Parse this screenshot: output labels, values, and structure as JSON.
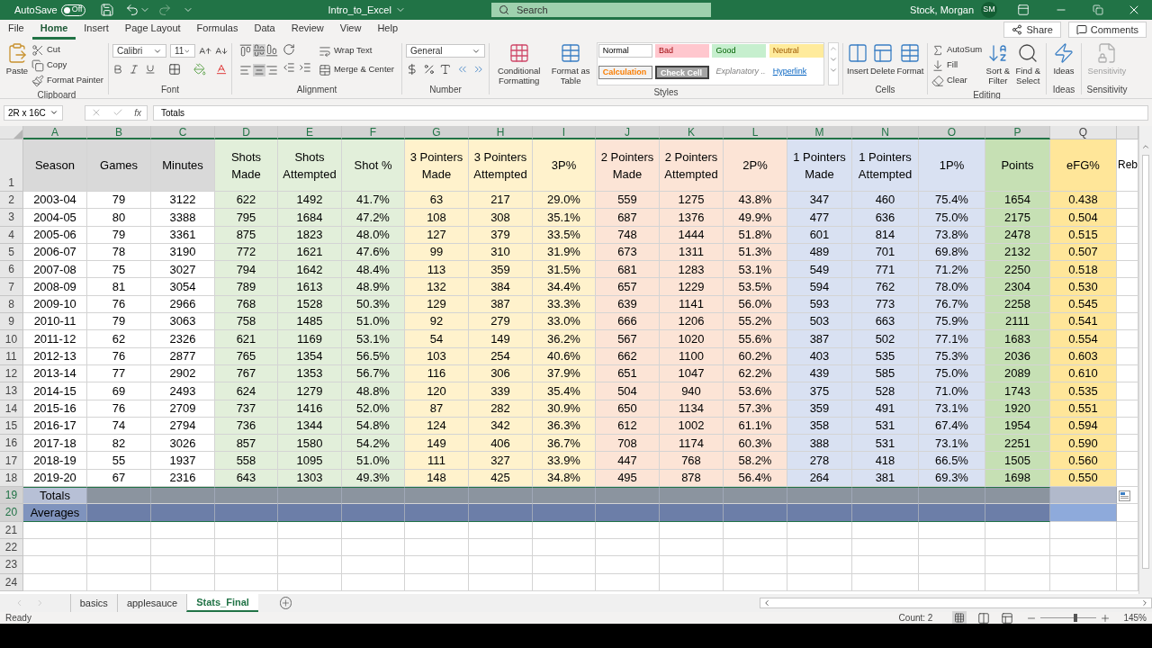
{
  "title_bar": {
    "autosave": {
      "label": "AutoSave",
      "state": "Off",
      "on": false
    },
    "filename": "Intro_to_Excel",
    "search": {
      "placeholder": "Search"
    },
    "user": "Stock, Morgan",
    "initials": "SM"
  },
  "tabs": [
    {
      "label": "File",
      "selected": false
    },
    {
      "label": "Home",
      "selected": true
    },
    {
      "label": "Insert",
      "selected": false
    },
    {
      "label": "Page Layout",
      "selected": false
    },
    {
      "label": "Formulas",
      "selected": false
    },
    {
      "label": "Data",
      "selected": false
    },
    {
      "label": "Review",
      "selected": false
    },
    {
      "label": "View",
      "selected": false
    },
    {
      "label": "Help",
      "selected": false
    }
  ],
  "share": "Share",
  "comments": "Comments",
  "ribbon": {
    "clipboard": {
      "label": "Clipboard",
      "paste": "Paste",
      "cut": "Cut",
      "copy": "Copy",
      "format_painter": "Format Painter"
    },
    "font": {
      "label": "Font",
      "name": "Calibri",
      "size": "11"
    },
    "alignment": {
      "label": "Alignment",
      "wrap": "Wrap Text",
      "merge": "Merge & Center"
    },
    "number": {
      "label": "Number",
      "format": "General"
    },
    "styles": {
      "label": "Styles",
      "conditional": "Conditional Formatting",
      "table": "Format as Table",
      "gallery": [
        {
          "label": "Normal",
          "kind": "normal"
        },
        {
          "label": "Bad",
          "kind": "bad"
        },
        {
          "label": "Good",
          "kind": "good"
        },
        {
          "label": "Neutral",
          "kind": "neutral"
        },
        {
          "label": "Calculation",
          "kind": "calculation"
        },
        {
          "label": "Check Cell",
          "kind": "check"
        },
        {
          "label": "Explanatory ...",
          "kind": "explanatory"
        },
        {
          "label": "Hyperlink",
          "kind": "hyperlink"
        }
      ]
    },
    "cells": {
      "label": "Cells",
      "insert": "Insert",
      "delete": "Delete",
      "format": "Format"
    },
    "editing": {
      "label": "Editing",
      "autosum": "AutoSum",
      "fill": "Fill",
      "clear": "Clear",
      "sort": "Sort & Filter",
      "find": "Find & Select"
    },
    "ideas": {
      "label": "Ideas",
      "button": "Ideas"
    },
    "sensitivity": {
      "label": "Sensitivity",
      "button": "Sensitivity",
      "disabled": true
    }
  },
  "formula_bar": {
    "name_box": "2R x 16C",
    "fx": "fx",
    "value": "Totals"
  },
  "header_row_number": "1",
  "columns": [
    {
      "letter": "A",
      "header": "Season",
      "color": "#d9d9d9",
      "shaded_body": false,
      "selected": true
    },
    {
      "letter": "B",
      "header": "Games",
      "color": "#d9d9d9",
      "shaded_body": false,
      "selected": true
    },
    {
      "letter": "C",
      "header": "Minutes",
      "color": "#d9d9d9",
      "shaded_body": false,
      "selected": true
    },
    {
      "letter": "D",
      "header": "Shots Made",
      "color": "#e2efda",
      "shaded_body": true,
      "selected": true
    },
    {
      "letter": "E",
      "header": "Shots Attempted",
      "color": "#e2efda",
      "shaded_body": true,
      "selected": true
    },
    {
      "letter": "F",
      "header": "Shot %",
      "color": "#e2efda",
      "shaded_body": true,
      "selected": true
    },
    {
      "letter": "G",
      "header": "3 Pointers Made",
      "color": "#fff2cc",
      "shaded_body": true,
      "selected": true
    },
    {
      "letter": "H",
      "header": "3 Pointers Attempted",
      "color": "#fff2cc",
      "shaded_body": true,
      "selected": true
    },
    {
      "letter": "I",
      "header": "3P%",
      "color": "#fff2cc",
      "shaded_body": true,
      "selected": true
    },
    {
      "letter": "J",
      "header": "2 Pointers Made",
      "color": "#fce4d6",
      "shaded_body": true,
      "selected": true
    },
    {
      "letter": "K",
      "header": "2 Pointers Attempted",
      "color": "#fce4d6",
      "shaded_body": true,
      "selected": true
    },
    {
      "letter": "L",
      "header": "2P%",
      "color": "#fce4d6",
      "shaded_body": true,
      "selected": true
    },
    {
      "letter": "M",
      "header": "1 Pointers Made",
      "color": "#d9e1f2",
      "shaded_body": true,
      "selected": true
    },
    {
      "letter": "N",
      "header": "1 Pointers Attempted",
      "color": "#d9e1f2",
      "shaded_body": true,
      "selected": true
    },
    {
      "letter": "O",
      "header": "1P%",
      "color": "#d9e1f2",
      "shaded_body": true,
      "selected": true
    },
    {
      "letter": "P",
      "header": "Points",
      "color": "#c6e0b4",
      "shaded_body": true,
      "selected": true
    },
    {
      "letter": "Q",
      "header": "eFG%",
      "color": "#ffe699",
      "shaded_body": true,
      "selected": false
    },
    {
      "header": "Reb",
      "color": "#ffffff",
      "shaded_body": false,
      "selected": false
    }
  ],
  "rows": [
    {
      "number": "2",
      "kind": "data",
      "selected": false,
      "cells": [
        "2003-04",
        "79",
        "3122",
        "622",
        "1492",
        "41.7%",
        "63",
        "217",
        "29.0%",
        "559",
        "1275",
        "43.8%",
        "347",
        "460",
        "75.4%",
        "1654",
        "0.438"
      ]
    },
    {
      "number": "3",
      "kind": "data",
      "selected": false,
      "cells": [
        "2004-05",
        "80",
        "3388",
        "795",
        "1684",
        "47.2%",
        "108",
        "308",
        "35.1%",
        "687",
        "1376",
        "49.9%",
        "477",
        "636",
        "75.0%",
        "2175",
        "0.504"
      ]
    },
    {
      "number": "4",
      "kind": "data",
      "selected": false,
      "cells": [
        "2005-06",
        "79",
        "3361",
        "875",
        "1823",
        "48.0%",
        "127",
        "379",
        "33.5%",
        "748",
        "1444",
        "51.8%",
        "601",
        "814",
        "73.8%",
        "2478",
        "0.515"
      ]
    },
    {
      "number": "5",
      "kind": "data",
      "selected": false,
      "cells": [
        "2006-07",
        "78",
        "3190",
        "772",
        "1621",
        "47.6%",
        "99",
        "310",
        "31.9%",
        "673",
        "1311",
        "51.3%",
        "489",
        "701",
        "69.8%",
        "2132",
        "0.507"
      ]
    },
    {
      "number": "6",
      "kind": "data",
      "selected": false,
      "cells": [
        "2007-08",
        "75",
        "3027",
        "794",
        "1642",
        "48.4%",
        "113",
        "359",
        "31.5%",
        "681",
        "1283",
        "53.1%",
        "549",
        "771",
        "71.2%",
        "2250",
        "0.518"
      ]
    },
    {
      "number": "7",
      "kind": "data",
      "selected": false,
      "cells": [
        "2008-09",
        "81",
        "3054",
        "789",
        "1613",
        "48.9%",
        "132",
        "384",
        "34.4%",
        "657",
        "1229",
        "53.5%",
        "594",
        "762",
        "78.0%",
        "2304",
        "0.530"
      ]
    },
    {
      "number": "8",
      "kind": "data",
      "selected": false,
      "cells": [
        "2009-10",
        "76",
        "2966",
        "768",
        "1528",
        "50.3%",
        "129",
        "387",
        "33.3%",
        "639",
        "1141",
        "56.0%",
        "593",
        "773",
        "76.7%",
        "2258",
        "0.545"
      ]
    },
    {
      "number": "9",
      "kind": "data",
      "selected": false,
      "cells": [
        "2010-11",
        "79",
        "3063",
        "758",
        "1485",
        "51.0%",
        "92",
        "279",
        "33.0%",
        "666",
        "1206",
        "55.2%",
        "503",
        "663",
        "75.9%",
        "2111",
        "0.541"
      ]
    },
    {
      "number": "10",
      "kind": "data",
      "selected": false,
      "cells": [
        "2011-12",
        "62",
        "2326",
        "621",
        "1169",
        "53.1%",
        "54",
        "149",
        "36.2%",
        "567",
        "1020",
        "55.6%",
        "387",
        "502",
        "77.1%",
        "1683",
        "0.554"
      ]
    },
    {
      "number": "11",
      "kind": "data",
      "selected": false,
      "cells": [
        "2012-13",
        "76",
        "2877",
        "765",
        "1354",
        "56.5%",
        "103",
        "254",
        "40.6%",
        "662",
        "1100",
        "60.2%",
        "403",
        "535",
        "75.3%",
        "2036",
        "0.603"
      ]
    },
    {
      "number": "12",
      "kind": "data",
      "selected": false,
      "cells": [
        "2013-14",
        "77",
        "2902",
        "767",
        "1353",
        "56.7%",
        "116",
        "306",
        "37.9%",
        "651",
        "1047",
        "62.2%",
        "439",
        "585",
        "75.0%",
        "2089",
        "0.610"
      ]
    },
    {
      "number": "13",
      "kind": "data",
      "selected": false,
      "cells": [
        "2014-15",
        "69",
        "2493",
        "624",
        "1279",
        "48.8%",
        "120",
        "339",
        "35.4%",
        "504",
        "940",
        "53.6%",
        "375",
        "528",
        "71.0%",
        "1743",
        "0.535"
      ]
    },
    {
      "number": "14",
      "kind": "data",
      "selected": false,
      "cells": [
        "2015-16",
        "76",
        "2709",
        "737",
        "1416",
        "52.0%",
        "87",
        "282",
        "30.9%",
        "650",
        "1134",
        "57.3%",
        "359",
        "491",
        "73.1%",
        "1920",
        "0.551"
      ]
    },
    {
      "number": "15",
      "kind": "data",
      "selected": false,
      "cells": [
        "2016-17",
        "74",
        "2794",
        "736",
        "1344",
        "54.8%",
        "124",
        "342",
        "36.3%",
        "612",
        "1002",
        "61.1%",
        "358",
        "531",
        "67.4%",
        "1954",
        "0.594"
      ]
    },
    {
      "number": "16",
      "kind": "data",
      "selected": false,
      "cells": [
        "2017-18",
        "82",
        "3026",
        "857",
        "1580",
        "54.2%",
        "149",
        "406",
        "36.7%",
        "708",
        "1174",
        "60.3%",
        "388",
        "531",
        "73.1%",
        "2251",
        "0.590"
      ]
    },
    {
      "number": "17",
      "kind": "data",
      "selected": false,
      "cells": [
        "2018-19",
        "55",
        "1937",
        "558",
        "1095",
        "51.0%",
        "111",
        "327",
        "33.9%",
        "447",
        "768",
        "58.2%",
        "278",
        "418",
        "66.5%",
        "1505",
        "0.560"
      ]
    },
    {
      "number": "18",
      "kind": "data",
      "selected": false,
      "cells": [
        "2019-20",
        "67",
        "2316",
        "643",
        "1303",
        "49.3%",
        "148",
        "425",
        "34.8%",
        "495",
        "878",
        "56.4%",
        "264",
        "381",
        "69.3%",
        "1698",
        "0.550"
      ]
    },
    {
      "number": "19",
      "kind": "totals",
      "selected": true,
      "label": "Totals"
    },
    {
      "number": "20",
      "kind": "averages",
      "selected": true,
      "label": "Averages"
    },
    {
      "number": "21",
      "kind": "empty",
      "selected": false
    },
    {
      "number": "22",
      "kind": "empty",
      "selected": false
    },
    {
      "number": "23",
      "kind": "empty",
      "selected": false
    },
    {
      "number": "24",
      "kind": "empty",
      "selected": false
    }
  ],
  "sheets": [
    {
      "label": "basics",
      "selected": false
    },
    {
      "label": "applesauce",
      "selected": false
    },
    {
      "label": "Stats_Final",
      "selected": true
    }
  ],
  "status_bar": {
    "mode": "Ready",
    "count": "Count: 2",
    "zoom": {
      "label": "145%",
      "level": 0.62
    }
  }
}
